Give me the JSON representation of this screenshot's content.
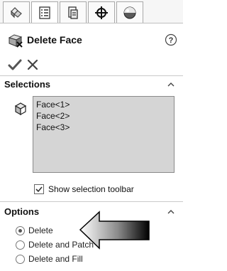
{
  "tabs": [
    {
      "icon": "feature-manager-icon"
    },
    {
      "icon": "property-manager-icon"
    },
    {
      "icon": "configuration-manager-icon"
    },
    {
      "icon": "dimxpert-manager-icon"
    },
    {
      "icon": "display-manager-icon"
    }
  ],
  "header": {
    "title": "Delete Face",
    "icon": "delete-face-icon",
    "help_icon": "help-icon"
  },
  "actions": {
    "ok_icon": "checkmark-icon",
    "cancel_icon": "close-icon"
  },
  "selections": {
    "title": "Selections",
    "items": [
      "Face<1>",
      "Face<2>",
      "Face<3>"
    ],
    "show_toolbar_label": "Show selection toolbar",
    "show_toolbar_checked": true
  },
  "options": {
    "title": "Options",
    "radios": [
      {
        "label": "Delete",
        "checked": true
      },
      {
        "label": "Delete and Patch",
        "checked": false
      },
      {
        "label": "Delete and Fill",
        "checked": false
      }
    ]
  },
  "colors": {
    "panel_bg": "#ffffff",
    "list_bg": "#d5d5d5",
    "text": "#111111"
  }
}
